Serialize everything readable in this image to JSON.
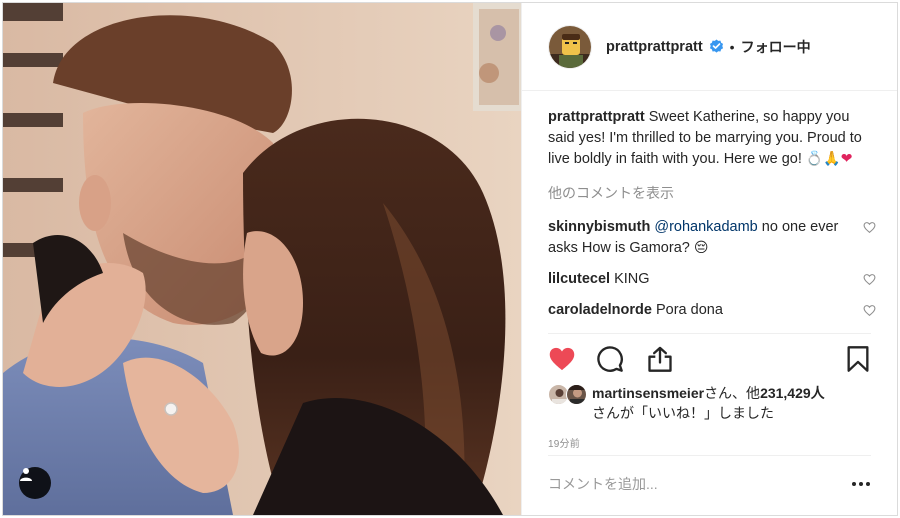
{
  "post": {
    "author": {
      "handle": "prattprattpratt",
      "follow_status": "フォロー中",
      "separator": "•",
      "verified_icon": "verified-badge-icon"
    },
    "caption": {
      "user": "prattprattpratt",
      "text": "Sweet Katherine, so happy you said yes! I'm thrilled to be marrying you. Proud to live boldly in faith with you. Here we go!",
      "emojis": [
        "💍",
        "🙏",
        "❤"
      ]
    },
    "view_more_comments": "他のコメントを表示",
    "comments": [
      {
        "user": "skinnybismuth",
        "mention": "@rohankadamb",
        "text": "no one ever asks How is Gamora?",
        "emoji": "😔"
      },
      {
        "user": "lilcutecel",
        "text": "KING"
      },
      {
        "user": "caroladelnorde",
        "text": "Pora dona"
      }
    ],
    "actions": {
      "like": "heart-filled-icon",
      "comment": "comment-bubble-icon",
      "share": "share-upload-icon",
      "save": "bookmark-icon"
    },
    "likes": {
      "first_liker": "martinsensmeier",
      "text_after_name": "さん、他",
      "count": "231,429",
      "text_suffix_1": "人",
      "text_suffix_2": "さんが「いいね！」しました"
    },
    "timestamp": "19分前",
    "add_comment_placeholder": "コメントを追加...",
    "colors": {
      "like_red": "#ed4956",
      "verified_blue": "#3897f0",
      "text": "#262626",
      "muted": "#8e8e8e",
      "mention": "#003569"
    }
  }
}
